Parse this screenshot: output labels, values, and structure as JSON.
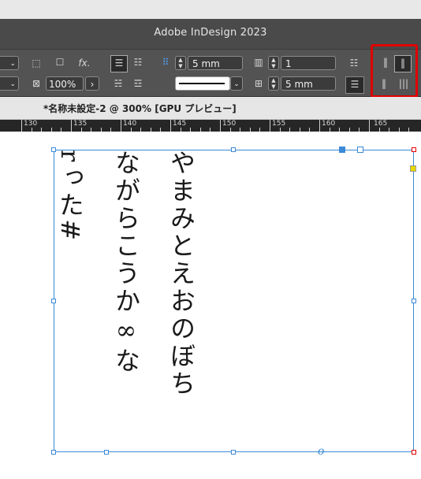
{
  "app": {
    "title": "Adobe InDesign 2023"
  },
  "control_panel": {
    "stroke_weight": "5 mm",
    "columns_count": "1",
    "gutter": "5 mm",
    "opacity": "100%",
    "fx_label": "fx."
  },
  "document": {
    "tab_name": "*名称未設定-2 @ 300% [GPU プレビュー]"
  },
  "ruler": {
    "labels": [
      "130",
      "135",
      "140",
      "145",
      "150",
      "155",
      "160",
      "165"
    ]
  },
  "text": {
    "col1": "やまみとえおのぼち",
    "col2": "ながらこうか∞な",
    "col3": "rった#"
  },
  "colors": {
    "accent": "#3c8ad6",
    "highlight": "#e00000",
    "yellow_handle": "#e8d800"
  }
}
